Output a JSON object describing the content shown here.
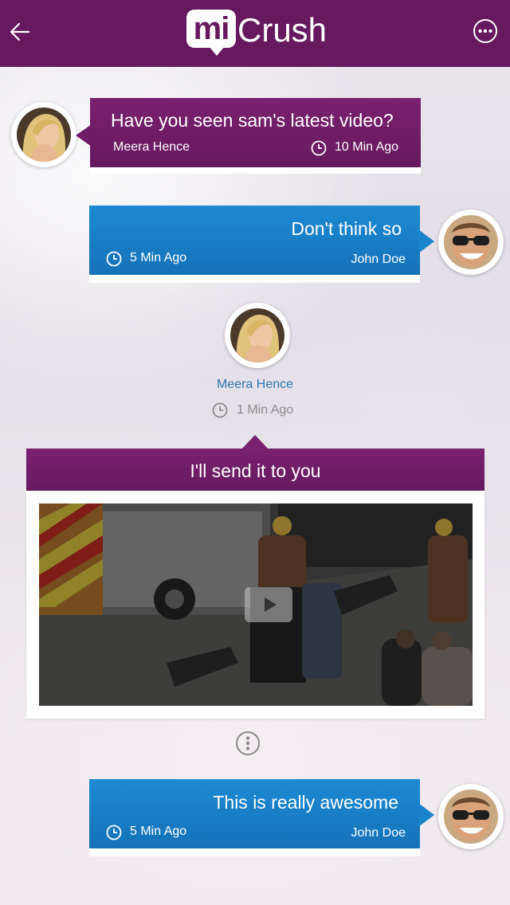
{
  "header": {
    "logo_badge": "mi",
    "logo_text": "Crush",
    "back_icon": "arrow-left-icon",
    "menu_icon": "more-horizontal-icon",
    "background": "#66195f"
  },
  "messages": [
    {
      "type": "incoming",
      "text": "Have you seen sam's latest video?",
      "sender": "Meera Hence",
      "time": "10 Min Ago",
      "color": "#66195f"
    },
    {
      "type": "outgoing",
      "text": "Don't think so",
      "sender": "John Doe",
      "time": "5 Min Ago",
      "color": "#1680c6"
    },
    {
      "type": "shared-video",
      "sender": "Meera Hence",
      "time": "1 Min Ago",
      "text": "I'll send it to you",
      "play_icon": "play-icon"
    },
    {
      "type": "outgoing",
      "text": "This is really awesome",
      "sender": "John Doe",
      "time": "5 Min Ago",
      "color": "#1680c6"
    }
  ],
  "options_icon": "more-vertical-icon"
}
